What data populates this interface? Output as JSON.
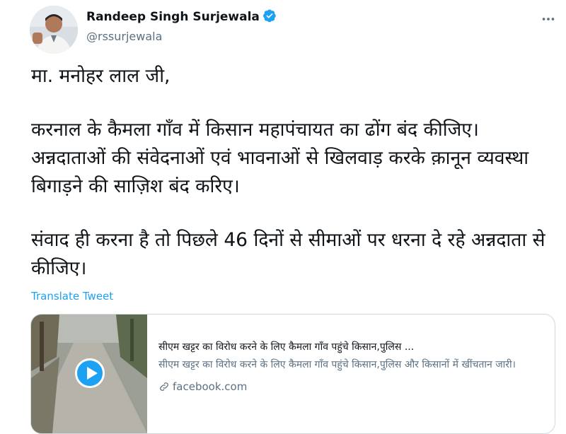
{
  "author": {
    "name": "Randeep Singh Surjewala",
    "handle": "@rssurjewala",
    "verified": true
  },
  "tweet": {
    "lines": [
      "मा. मनोहर लाल जी,",
      "करनाल के कैमला गाँव में किसान महापंचायत का ढोंग बंद कीजिए। अन्नदाताओं की संवेदनाओं एवं भावनाओं से खिलवाड़ करके क़ानून व्यवस्था बिगाड़ने की साज़िश बंद करिए।",
      "संवाद ही करना है तो पिछले 46 दिनों से सीमाओं पर धरना दे रहे अन्नदाता से कीजिए।"
    ],
    "translate_label": "Translate Tweet"
  },
  "card": {
    "title": "सीएम खट्टर का विरोध करने के लिए कैमला गाँव पहुंचे किसान,पुलिस ...",
    "description": "सीएम खट्टर का विरोध करने के लिए कैमला गाँव पहुंचे किसान,पुलिस और किसानों में खींचतान जारी।",
    "domain": "facebook.com"
  },
  "colors": {
    "accent": "#1da1f2",
    "text": "#0f1419",
    "secondary": "#5b7083"
  },
  "icons": {
    "menu": "more-icon",
    "verified": "verified-badge-icon",
    "play": "play-icon",
    "link": "link-icon"
  }
}
